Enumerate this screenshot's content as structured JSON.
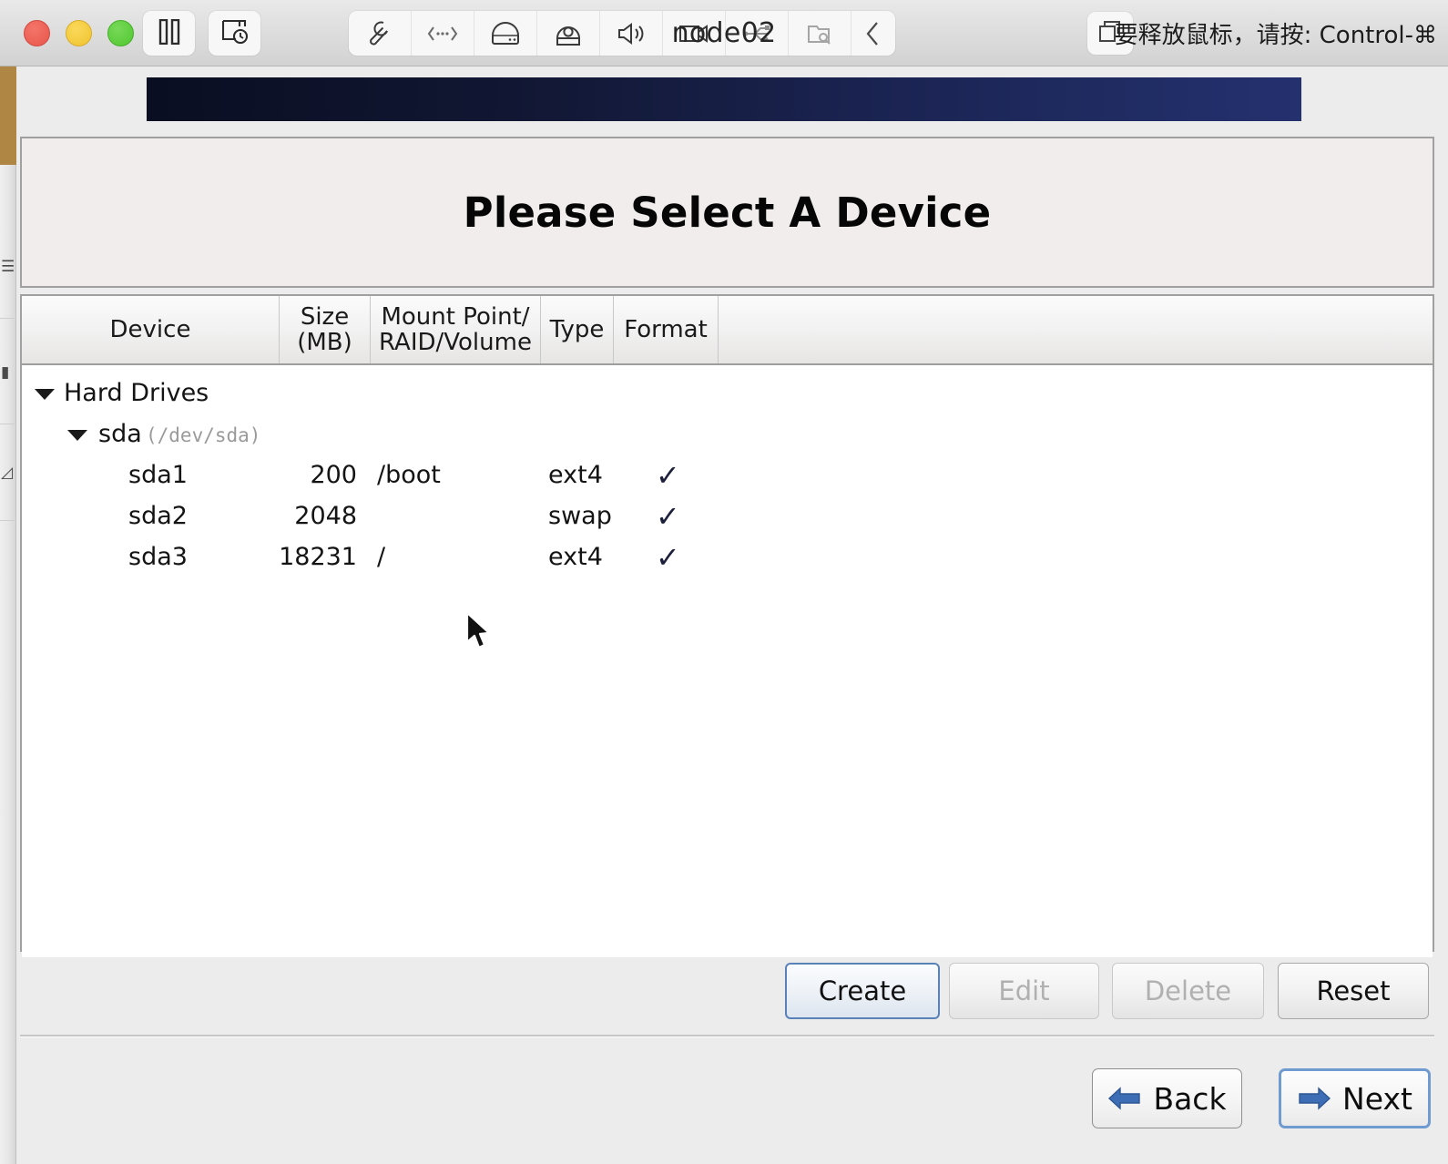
{
  "vm_window": {
    "title": "node02",
    "release_hint": "要释放鼠标，请按: Control-⌘",
    "window_controls": [
      {
        "name": "close",
        "color": "#e8554a"
      },
      {
        "name": "minimize",
        "color": "#f1c42f"
      },
      {
        "name": "zoom",
        "color": "#4fc62e"
      }
    ],
    "left_buttons": [
      {
        "name": "pause-button",
        "icon": "pause-icon"
      },
      {
        "name": "snapshot-button",
        "icon": "snapshot-clock-icon"
      }
    ],
    "toolbar_icons": [
      {
        "name": "settings-wrench-icon",
        "label": "wrench"
      },
      {
        "name": "network-icon",
        "label": "network"
      },
      {
        "name": "hard-disk-icon",
        "label": "hard-disk"
      },
      {
        "name": "optical-drive-icon",
        "label": "optical-drive"
      },
      {
        "name": "sound-icon",
        "label": "sound"
      },
      {
        "name": "video-camera-icon",
        "label": "video"
      },
      {
        "name": "usb-icon",
        "label": "usb"
      },
      {
        "name": "shared-folder-icon",
        "label": "shared-folder"
      },
      {
        "name": "collapse-chevron-icon",
        "label": "collapse"
      }
    ],
    "fullscreen_button": {
      "name": "fullscreen-toggle",
      "icon": "overlapping-squares-icon"
    }
  },
  "installer": {
    "page_title": "Please Select A Device",
    "table": {
      "columns": [
        {
          "key": "device",
          "label": "Device"
        },
        {
          "key": "size",
          "label": "Size\n(MB)",
          "line1": "Size",
          "line2": "(MB)"
        },
        {
          "key": "mount",
          "label": "Mount Point/\nRAID/Volume",
          "line1": "Mount Point/",
          "line2": "RAID/Volume"
        },
        {
          "key": "type",
          "label": "Type"
        },
        {
          "key": "format",
          "label": "Format"
        }
      ],
      "groups": [
        {
          "label": "Hard Drives",
          "expanded": true,
          "drives": [
            {
              "name": "sda",
              "path": "(/dev/sda)",
              "expanded": true,
              "partitions": [
                {
                  "device": "sda1",
                  "size": "200",
                  "mount": "/boot",
                  "type": "ext4",
                  "format": "✓"
                },
                {
                  "device": "sda2",
                  "size": "2048",
                  "mount": "",
                  "type": "swap",
                  "format": "✓"
                },
                {
                  "device": "sda3",
                  "size": "18231",
                  "mount": "/",
                  "type": "ext4",
                  "format": "✓"
                }
              ]
            }
          ]
        }
      ]
    },
    "action_buttons": [
      {
        "name": "create-button",
        "label": "Create",
        "enabled": true,
        "focused": true
      },
      {
        "name": "edit-button",
        "label": "Edit",
        "enabled": false,
        "focused": false
      },
      {
        "name": "delete-button",
        "label": "Delete",
        "enabled": false,
        "focused": false
      },
      {
        "name": "reset-button",
        "label": "Reset",
        "enabled": true,
        "focused": false
      }
    ],
    "nav_buttons": [
      {
        "name": "back-button",
        "label": "Back",
        "icon": "arrow-left-icon",
        "focused": false
      },
      {
        "name": "next-button",
        "label": "Next",
        "icon": "arrow-right-icon",
        "focused": true
      }
    ],
    "colors": {
      "banner_start": "#0a0e22",
      "banner_end": "#24316f",
      "accent_blue": "#3c6db5",
      "focus_blue": "#6f9bd1",
      "check_mark": "#1c1f3a"
    }
  }
}
